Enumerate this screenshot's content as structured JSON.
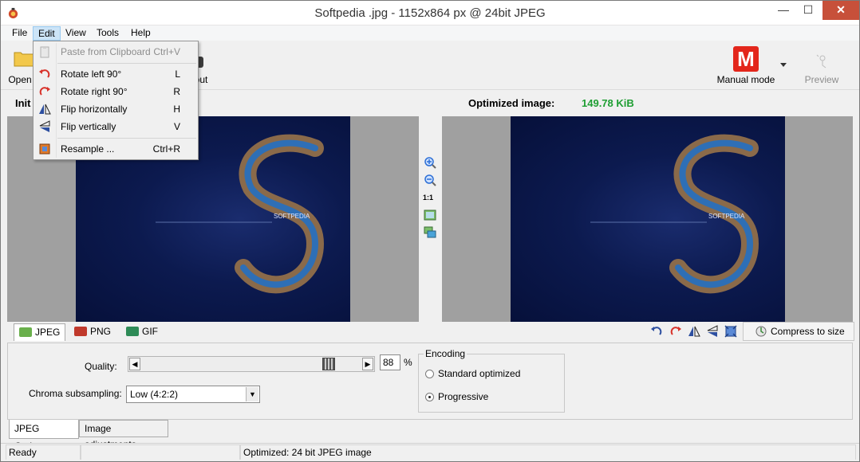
{
  "window": {
    "title": "Softpedia .jpg - 1152x864 px @ 24bit JPEG",
    "minimize": "—",
    "maximize": "☐",
    "close": "✕"
  },
  "menubar": {
    "items": [
      "File",
      "Edit",
      "View",
      "Tools",
      "Help"
    ]
  },
  "toolbar": {
    "open_label": "Open",
    "about_label": "out",
    "mode_label": "Manual mode",
    "mode_icon_letter": "M",
    "preview_label": "Preview"
  },
  "infobar": {
    "left_label": "Init",
    "optimized_label": "Optimized image:",
    "optimized_size": "149.78 KiB"
  },
  "image": {
    "caption": "SOFTPEDIA",
    "watermark_color": "#0c1a4f"
  },
  "middle_tools": {
    "zoom_ratio": "1:1"
  },
  "format_tabs": [
    {
      "label": "JPEG",
      "active": true
    },
    {
      "label": "PNG",
      "active": false
    },
    {
      "label": "GIF",
      "active": false
    }
  ],
  "compress": {
    "label": "Compress to size"
  },
  "options": {
    "quality_label": "Quality:",
    "quality_value": "88",
    "quality_unit": "%",
    "chroma_label": "Chroma subsampling:",
    "chroma_value": "Low (4:2:2)",
    "encoding_title": "Encoding",
    "encoding_options": [
      "Standard optimized",
      "Progressive"
    ],
    "encoding_selected": "Progressive"
  },
  "bottom_tabs": [
    "JPEG Options",
    "Image adjustments"
  ],
  "status": {
    "left": "Ready",
    "middle": "",
    "right": "Optimized: 24 bit JPEG image"
  },
  "edit_menu": {
    "items": [
      {
        "label": "Paste from Clipboard",
        "shortcut": "Ctrl+V",
        "enabled": false,
        "icon": "paste-icon"
      },
      {
        "label": "Rotate left 90°",
        "shortcut": "L",
        "enabled": true,
        "icon": "rotate-left-icon"
      },
      {
        "label": "Rotate right 90°",
        "shortcut": "R",
        "enabled": true,
        "icon": "rotate-right-icon"
      },
      {
        "label": "Flip horizontally",
        "shortcut": "H",
        "enabled": true,
        "icon": "flip-horizontal-icon"
      },
      {
        "label": "Flip vertically",
        "shortcut": "V",
        "enabled": true,
        "icon": "flip-vertical-icon"
      },
      {
        "label": "Resample ...",
        "shortcut": "Ctrl+R",
        "enabled": true,
        "icon": "resample-icon"
      }
    ]
  },
  "colors": {
    "size_green": "#1e9e32",
    "mode_red": "#e3261b",
    "close_red": "#c7503a",
    "rotate_red": "#d8322a",
    "accent_blue": "#2d6fd6"
  }
}
